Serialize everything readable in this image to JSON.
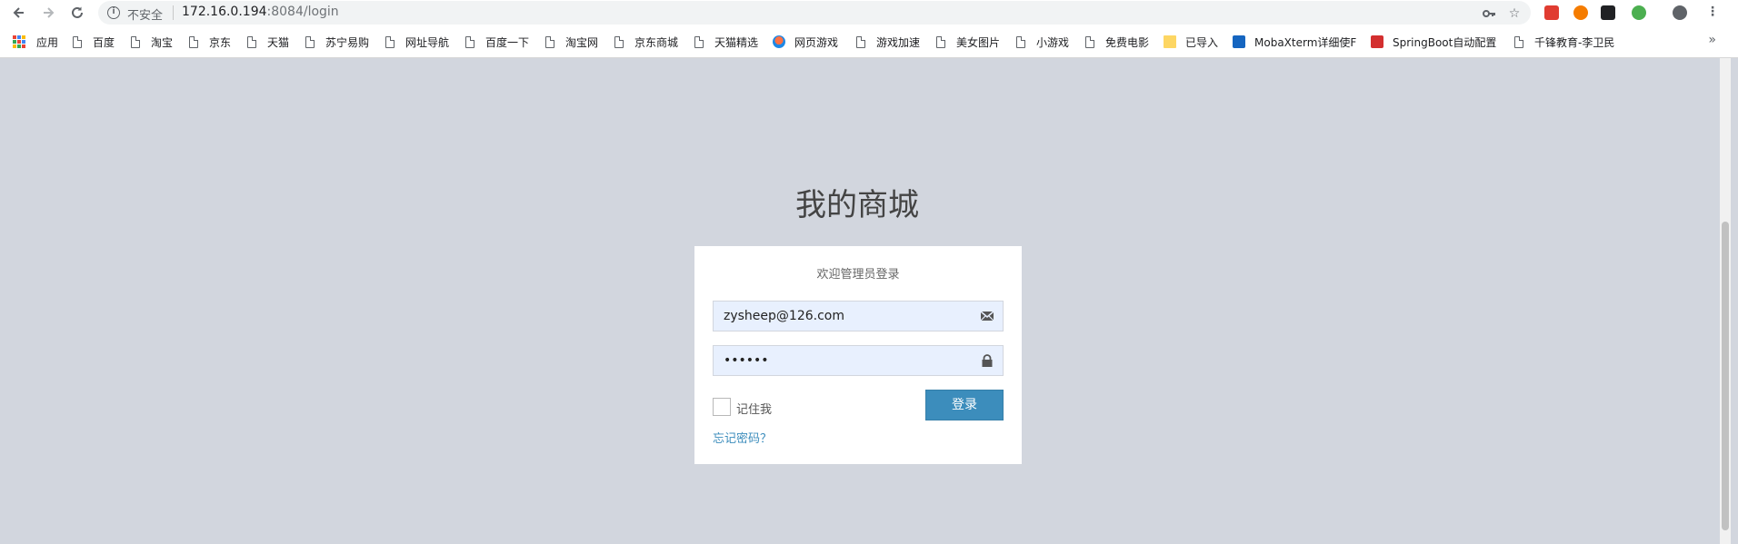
{
  "browser": {
    "security_label": "不安全",
    "url_host": "172.16.0.194",
    "url_rest": ":8084/login",
    "bookmarks": [
      "应用",
      "百度",
      "淘宝",
      "京东",
      "天猫",
      "苏宁易购",
      "网址导航",
      "百度一下",
      "淘宝网",
      "京东商城",
      "天猫精选",
      "网页游戏",
      "游戏加速",
      "美女图片",
      "小游戏",
      "免费电影",
      "已导入",
      "MobaXterm详细使F",
      "SpringBoot自动配置",
      "千锋教育-李卫民"
    ],
    "more": "»"
  },
  "page": {
    "title": "我的商城",
    "login_message": "欢迎管理员登录",
    "email_value": "zysheep@126.com",
    "password_value": "••••••",
    "remember_label": "记住我",
    "submit_label": "登录",
    "forgot_label": "忘记密码？"
  },
  "colors": {
    "page_background": "#d2d6de",
    "primary_button": "#3c8dbc",
    "link": "#3c8dbc",
    "input_background": "#e8f0fe"
  }
}
